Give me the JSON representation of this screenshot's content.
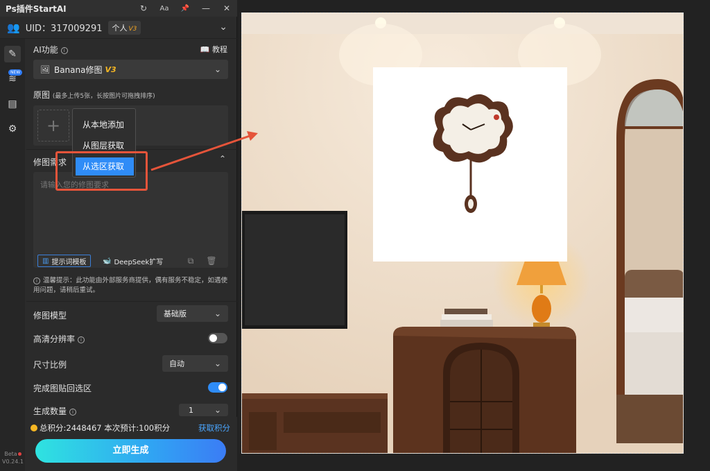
{
  "titlebar": {
    "title": "Ps插件StartAI",
    "icons": [
      "refresh-icon",
      "font-size-icon",
      "pin-icon",
      "minimize-icon",
      "close-icon"
    ],
    "refresh": "↻",
    "font": "Aa",
    "pin": "📌",
    "minimize": "—",
    "close": "✕"
  },
  "user": {
    "uid": "UID：317009291",
    "plan": "个人",
    "plan_version": "V3"
  },
  "rail": {
    "new_tag": "NEW",
    "beta": "Beta",
    "version": "V0.24.1"
  },
  "ai": {
    "label": "AI功能",
    "tutorial": "教程",
    "function_select": "Banana修图",
    "function_version": "V3"
  },
  "source": {
    "label": "原图",
    "hint": "(最多上传5张，长按图片可拖拽排序)",
    "menu": [
      "从本地添加",
      "从图层获取",
      "从选区获取"
    ],
    "highlighted_index": 2
  },
  "prompt": {
    "label": "修图需求",
    "placeholder": "请输入您的修图要求",
    "template_btn": "提示词模板",
    "deepseek_btn": "DeepSeek扩写"
  },
  "notice": "温馨提示：此功能由外部服务商提供，偶有服务不稳定，如遇使用问题，请稍后重试。",
  "settings": {
    "model_label": "修图模型",
    "model_value": "基础版",
    "hd_label": "高清分辨率",
    "hd_on": false,
    "ratio_label": "尺寸比例",
    "ratio_value": "自动",
    "paste_label": "完成图贴回选区",
    "paste_on": true,
    "count_label": "生成数量",
    "count_value": "1"
  },
  "footer": {
    "total_points": "总积分:2448467",
    "estimate": "本次预计:100积分",
    "get_points": "获取积分",
    "generate": "立即生成"
  },
  "colors": {
    "accent_blue": "#2f8cf7",
    "highlight_red": "#e5543a",
    "gold": "#f5b623"
  }
}
